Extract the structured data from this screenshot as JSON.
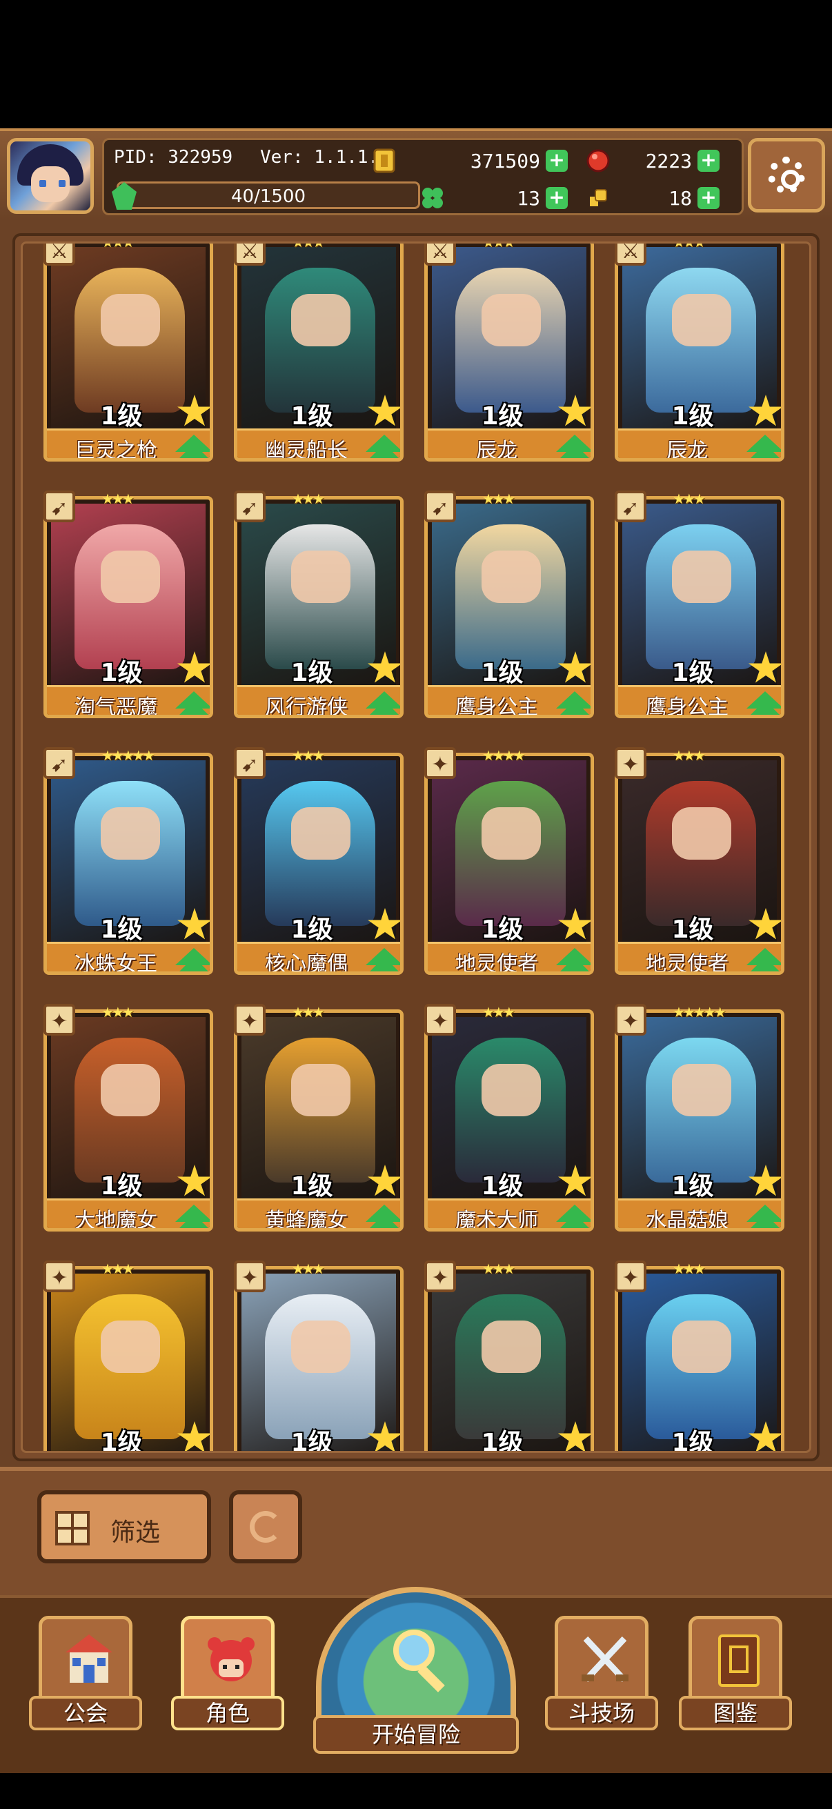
{
  "player": {
    "pid": "PID: 322959",
    "version": "Ver: 1.1.1.0",
    "xp": "40/1500"
  },
  "resources": {
    "gold": "371509",
    "ruby": "2223",
    "clover": "13",
    "key": "18"
  },
  "heroes": [
    {
      "level": "1级",
      "name": "巨灵之枪",
      "rank": "★★★",
      "class": "melee",
      "color": "#e8b35a",
      "bg": "#6e3b22"
    },
    {
      "level": "1级",
      "name": "幽灵船长",
      "rank": "★★★",
      "class": "melee",
      "color": "#2f8a7a",
      "bg": "#23343a"
    },
    {
      "level": "1级",
      "name": "辰龙",
      "rank": "★★★",
      "class": "melee",
      "color": "#e8d4b0",
      "bg": "#3c5a8c"
    },
    {
      "level": "1级",
      "name": "辰龙",
      "rank": "★★★",
      "class": "melee",
      "color": "#8ed8f0",
      "bg": "#3c6a9c"
    },
    {
      "level": "1级",
      "name": "淘气恶魔",
      "rank": "★★★",
      "class": "ranged",
      "color": "#f0a8a8",
      "bg": "#b24050"
    },
    {
      "level": "1级",
      "name": "风行游侠",
      "rank": "★★★",
      "class": "ranged",
      "color": "#e6e6e6",
      "bg": "#2a4a4a"
    },
    {
      "level": "1级",
      "name": "鹰身公主",
      "rank": "★★★",
      "class": "ranged",
      "color": "#f2d7a0",
      "bg": "#3a6a8a"
    },
    {
      "level": "1级",
      "name": "鹰身公主",
      "rank": "★★★",
      "class": "ranged",
      "color": "#7cd0f0",
      "bg": "#3a5a8a"
    },
    {
      "level": "1级",
      "name": "冰蛛女王",
      "rank": "★★★★★",
      "class": "ranged",
      "color": "#8fe0f8",
      "bg": "#2f5a8a"
    },
    {
      "level": "1级",
      "name": "核心魔偶",
      "rank": "★★★",
      "class": "ranged",
      "color": "#56c8f0",
      "bg": "#263a5a"
    },
    {
      "level": "1级",
      "name": "地灵使者",
      "rank": "★★★★",
      "class": "magic",
      "color": "#5ea24a",
      "bg": "#5a2a4a"
    },
    {
      "level": "1级",
      "name": "地灵使者",
      "rank": "★★★",
      "class": "magic",
      "color": "#b03a2a",
      "bg": "#3a2a2a"
    },
    {
      "level": "1级",
      "name": "大地魔女",
      "rank": "★★★",
      "class": "magic",
      "color": "#c8602a",
      "bg": "#6a3a22"
    },
    {
      "level": "1级",
      "name": "黄蜂魔女",
      "rank": "★★★",
      "class": "magic",
      "color": "#e6a030",
      "bg": "#4a3a2a"
    },
    {
      "level": "1级",
      "name": "魔术大师",
      "rank": "★★★",
      "class": "magic",
      "color": "#2a8a6a",
      "bg": "#2a2a3a"
    },
    {
      "level": "1级",
      "name": "水晶菇娘",
      "rank": "★★★★★",
      "class": "magic",
      "color": "#7cd8f0",
      "bg": "#3a6a9a"
    },
    {
      "level": "1级",
      "name": "",
      "rank": "★★★",
      "class": "magic",
      "color": "#f4c230",
      "bg": "#c8841a"
    },
    {
      "level": "1级",
      "name": "",
      "rank": "★★★",
      "class": "magic",
      "color": "#e8eef4",
      "bg": "#8aa2b8"
    },
    {
      "level": "1级",
      "name": "",
      "rank": "★★★",
      "class": "magic",
      "color": "#2a7a5a",
      "bg": "#3a3a3a"
    },
    {
      "level": "1级",
      "name": "",
      "rank": "★★★",
      "class": "magic",
      "color": "#6ad0f0",
      "bg": "#2a5a9a"
    }
  ],
  "toolbar": {
    "filter_label": "筛选"
  },
  "nav": {
    "guild": "公会",
    "heroes": "角色",
    "adventure": "开始冒险",
    "arena": "斗技场",
    "codex": "图鉴"
  }
}
